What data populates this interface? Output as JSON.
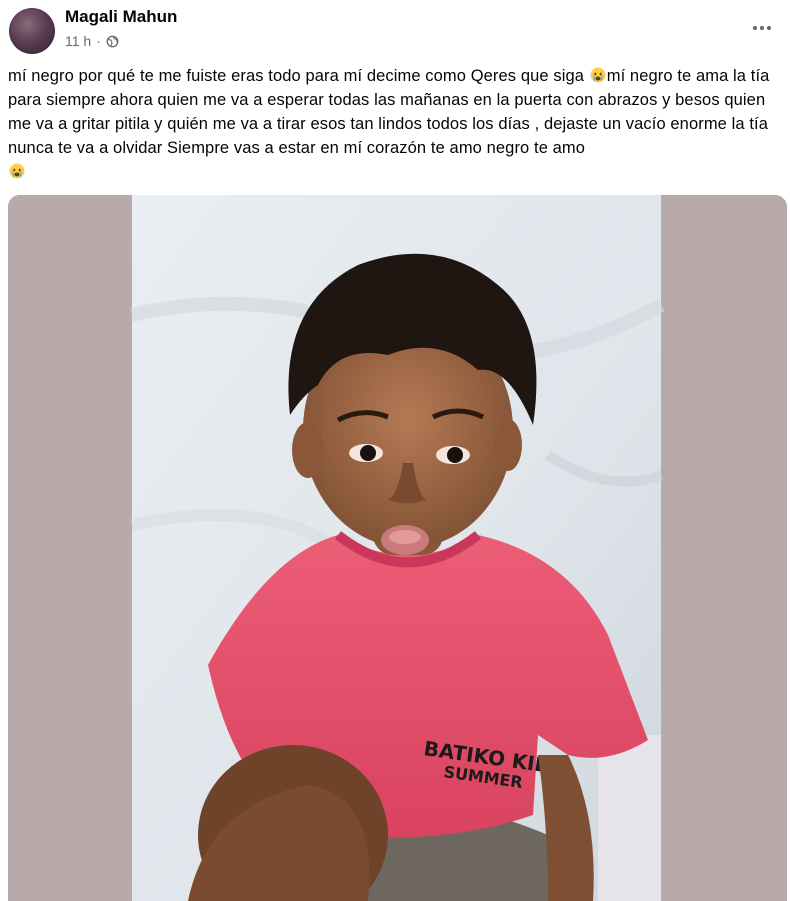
{
  "post": {
    "author": "Magali Mahun",
    "time": "11 h",
    "separator": "·",
    "audience_icon": "globe-icon",
    "more_icon": "more-options-icon",
    "text_parts": [
      "mí negro por qué te me fuiste eras todo para mí decime como Qeres que siga ",
      "mí negro te ama la tía para siempre ahora quien me va a esperar todas las mañanas en la puerta con abrazos y besos quien me va a gritar pitila y quién me va a tirar esos tan lindos todos los días , dejaste un vacío enorme la tía nunca te va a olvidar Siempre vas a estar en mí corazón te amo negro te amo "
    ],
    "emoji_icon": "crying-face-emoji-icon",
    "photo_shirt_text": [
      "BATIKO KID",
      "SUMMER"
    ]
  },
  "colors": {
    "secondary_text": "#65676b",
    "photo_side_bg": "#b8a9ab",
    "shirt": "#e8536e"
  }
}
